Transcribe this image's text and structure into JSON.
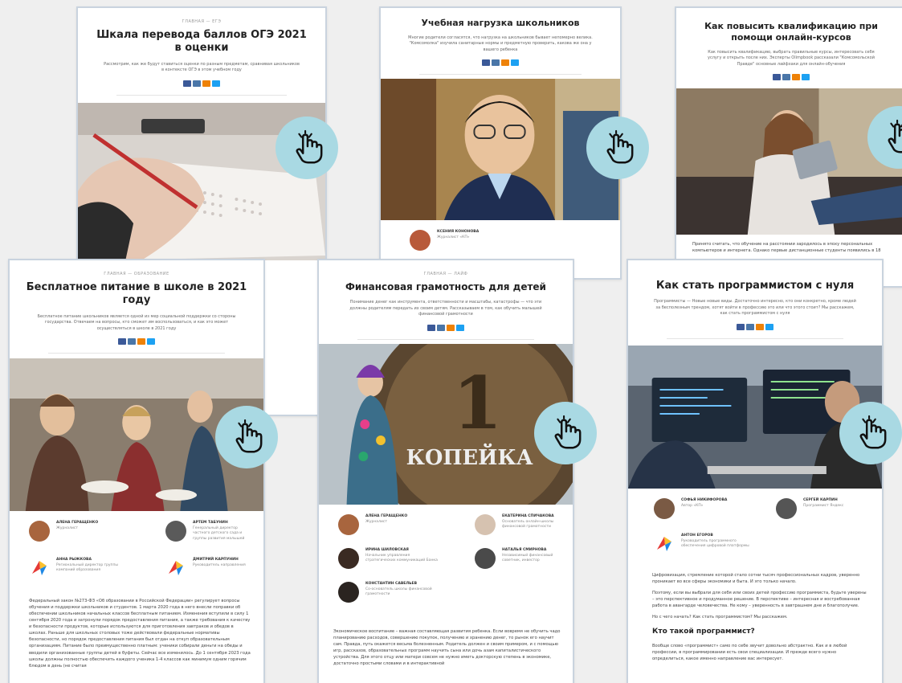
{
  "cards": {
    "oge": {
      "breadcrumb": "ГЛАВНАЯ — ЕГЭ",
      "title_line1": "Шкала перевода баллов ОГЭ 2021",
      "title_line2": "в оценки",
      "lead": "Рассмотрим, как же будут ставиться оценки по разным предметам, сравнивая школьников в контексте ОГЭ в этом учебном году"
    },
    "load": {
      "title": "Учебная нагрузка школьников",
      "lead": "Многие родители согласятся, что нагрузка на школьников бывает непомерно велика. \"Комсомолка\" изучила санитарные нормы и предметную проверить, какова же она у вашего ребенка",
      "author_name": "КСЕНИЯ КОНОНОВА",
      "author_role": "Журналист «КП»"
    },
    "qual": {
      "title_line1": "Как повысить квалификацию при",
      "title_line2": "помощи онлайн-курсов",
      "lead": "Как повысить квалификацию, выбрать правильные курсы, интересовать себя услугу и открыть после них. Эксперты Olimpbook рассказали \"Комсомольской Правде\" основные лайфхаки для онлайн-обучения",
      "body": "Принято считать, что обучение на расстоянии зародилось в эпоху персональных компьютеров и интернета. Однако первые дистанционные студенты появились в 18"
    },
    "food": {
      "breadcrumb": "ГЛАВНАЯ — ОБРАЗОВАНИЕ",
      "title_line1": "Бесплатное питание в школе в 2021",
      "title_line2": "году",
      "lead": "Бесплатное питание школьников является одной из мер социальной поддержки со стороны государства. Отвечаем на вопросы, кто сможет им воспользоваться, и как это может осуществляться в школе в 2021 году",
      "authors": [
        {
          "name": "АЛЕНА ГЕРАЩЕНКО",
          "role": "Журналист"
        },
        {
          "name": "АРТЕМ ТАБУНИН",
          "role": "Генеральный директор частного детского сада и группы развития малышей"
        },
        {
          "name": "АННА РЫЖКОВА",
          "role": "Региональный директор группы компаний образования"
        },
        {
          "name": "ДМИТРИЙ КАРПУНИН",
          "role": "Руководитель направления"
        }
      ],
      "body": "Федеральный закон №273-ФЗ «Об образовании в Российской Федерации» регулирует вопросы обучения и поддержки школьников и студентов. 1 марта 2020 года в него внесли поправки об обеспечении школьников начальных классов бесплатным питанием. Изменения вступили в силу 1 сентября 2020 года и затронули порядок предоставления питания, а также требования к качеству и безопасности продуктов, которые используются для приготовления завтраков и обедов в школах. Раньше для школьных столовых тоже действовали федеральные нормативы безопасности, но порядок предоставления питания был отдан на откуп образовательным организациям. Питание было преимущественно платным: ученики собирали деньги на обеды и вводили организованные группы детей в буфеты. Сейчас все изменилось. До 1 сентября 2023 года школы должны полностью обеспечить каждого ученика 1-4 классов как минимум одним горячим блюдом в день (не считая"
    },
    "money": {
      "breadcrumb": "ГЛАВНАЯ — ЛАЙФ",
      "title": "Финансовая грамотность для детей",
      "lead": "Понимание денег как инструмента, ответственности и масштабы, катастрофы — что эти должны родителям передать их своим детям. Рассказываем в том, как обучить малышей финансовой грамотности",
      "coin_number": "1",
      "coin_word": "КОПЕЙКА",
      "authors": [
        {
          "name": "АЛЕНА ГЕРАЩЕНКО",
          "role": "Журналист"
        },
        {
          "name": "ЕКАТЕРИНА СПИЧАКОВА",
          "role": "Основатель онлайн-школы финансовой грамотности"
        },
        {
          "name": "ИРИНА ШИЛОВСКАЯ",
          "role": "Начальник управления стратегических коммуникаций Банка"
        },
        {
          "name": "НАТАЛЬЯ СМИРНОВА",
          "role": "Независимый финансовый советник, инвестор"
        },
        {
          "name": "КОНСТАНТИН САВЕЛЬЕВ",
          "role": "Со-основатель школы финансовой грамотности"
        }
      ],
      "body": "Экономическое воспитание – важная составляющая развития ребенка. Если вовремя не обучить чадо планированию расходов, совершению покупок, получению и хранению денег, то рынок его научит сам. Правда, путь окажется весьма болезненным. Родитель должен и своим примером, и с помощью игр, рассказов, образовательных программ научить сына или дочь азам капиталистического устройства. Для этого отцу или матери совсем не нужно иметь докторскую степень в экономике, достаточно простыми словами и в интерактивной"
    },
    "prog": {
      "title": "Как стать программистом с нуля",
      "lead": "Программисты — Новые новые виды. Достаточно интересно, кто они конкретно, кроме людей за бесполезным трендом, хотят войти в профессию это или что этого стоит? Мы расскажем, как стать программистом с нуля",
      "authors": [
        {
          "name": "СОФЬЯ НИКИФОРОВА",
          "role": "Автор «КП»"
        },
        {
          "name": "СЕРГЕЙ КАРПИН",
          "role": "Программист Яндекс"
        },
        {
          "name": "АНТОН ЕГОРОВ",
          "role": "Руководитель программного обеспечения цифровой платформы"
        }
      ],
      "body1": "Цифровизация, стремление которой стало сотни тысяч профессиональных кадров, уверенно проникает во все сферы экономики и быта. И это только начало.",
      "body2": "Поэтому, если вы выбрали для себя или своих детей профессию программиста, будьте уверены – это перспективное и продуманное решение. В перспективе – интересная и востребованная работа в авангарде человечества. Не кому – уверенность в завтрашнем дне и благополучие.",
      "body3": "Но с чего начать? Как стать программистом? Мы расскажем.",
      "heading": "Кто такой программист?",
      "body4": "Вообще слово «программист» само по себе звучит довольно абстрактно. Как и в любой профессии, в программировании есть свои специализации. И прежде всего нужно определиться, какое именно направление вас интересует."
    }
  }
}
